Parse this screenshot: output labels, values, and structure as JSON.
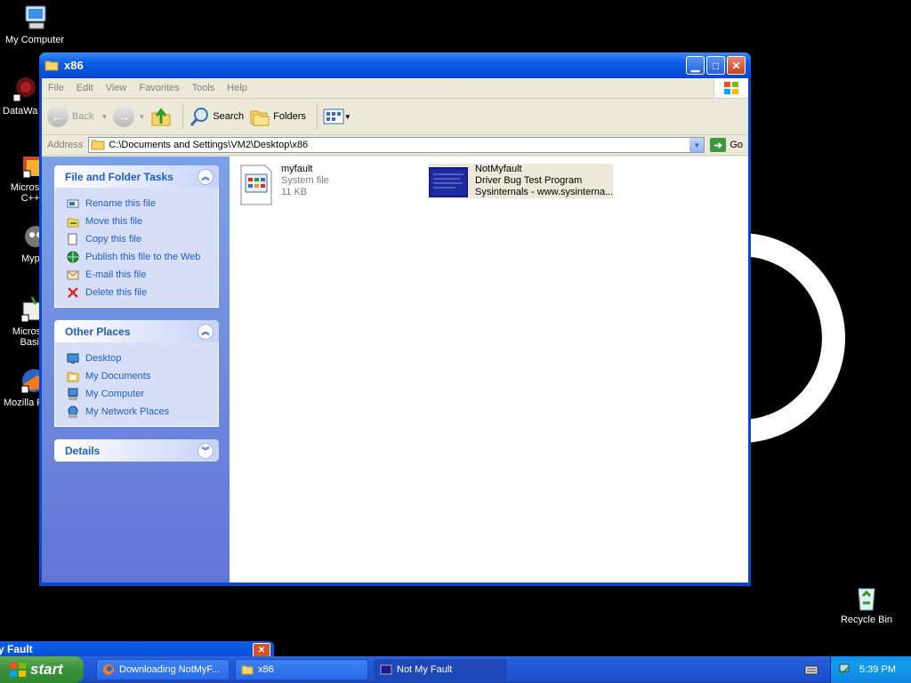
{
  "desktop": {
    "icons": [
      {
        "label": "My Computer",
        "name": "my-computer-icon"
      },
      {
        "label": "DataWa",
        "name": "datawarehouse-icon"
      },
      {
        "label": "Microsoft C++",
        "name": "microsoft-cpp-icon"
      },
      {
        "label": "Myp",
        "name": "myp-icon"
      },
      {
        "label": "Microsoft Basic",
        "name": "microsoft-basic-icon"
      },
      {
        "label": "Mozilla F",
        "name": "mozilla-firefox-icon"
      }
    ],
    "recycle_bin": "Recycle Bin"
  },
  "window": {
    "title": "x86",
    "menu": [
      "File",
      "Edit",
      "View",
      "Favorites",
      "Tools",
      "Help"
    ],
    "toolbar": {
      "back": "Back",
      "search": "Search",
      "folders": "Folders"
    },
    "address": {
      "label": "Address",
      "value": "C:\\Documents and Settings\\VM2\\Desktop\\x86",
      "go": "Go"
    },
    "tasks_panel": {
      "title": "File and Folder Tasks",
      "items": [
        "Rename this file",
        "Move this file",
        "Copy this file",
        "Publish this file to the Web",
        "E-mail this file",
        "Delete this file"
      ]
    },
    "places_panel": {
      "title": "Other Places",
      "items": [
        "Desktop",
        "My Documents",
        "My Computer",
        "My Network Places"
      ]
    },
    "details_panel": {
      "title": "Details"
    },
    "files": [
      {
        "name": "myfault",
        "line2": "System file",
        "line3": "11 KB"
      },
      {
        "name": "NotMyfault",
        "line2": "Driver Bug Test Program",
        "line3": "Sysinternals - www.sysinterna..."
      }
    ]
  },
  "background_window": {
    "title": "y Fault"
  },
  "taskbar": {
    "start": "start",
    "tasks": [
      "Downloading NotMyF...",
      "x86",
      "Not My Fault"
    ],
    "time": "5:39 PM"
  }
}
